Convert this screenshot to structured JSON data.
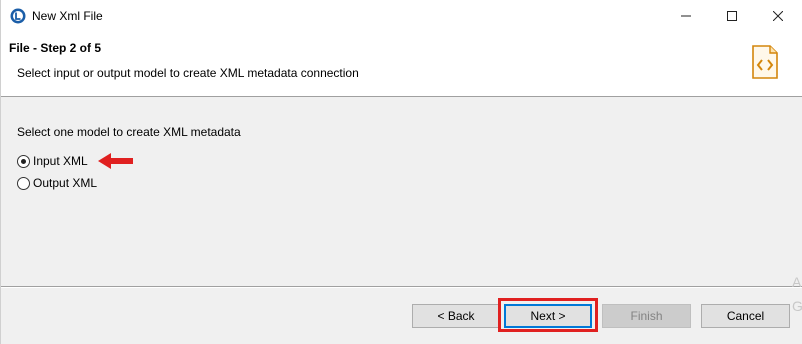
{
  "window": {
    "title": "New Xml File",
    "controls": [
      "minimize",
      "maximize",
      "close"
    ]
  },
  "banner": {
    "step_title": "File - Step 2 of 5",
    "description": "Select input or output model to create XML metadata connection",
    "icon": "xml-file-icon"
  },
  "content": {
    "prompt": "Select one model to create XML metadata",
    "options": [
      {
        "label": "Input XML",
        "selected": true
      },
      {
        "label": "Output XML",
        "selected": false
      }
    ]
  },
  "buttons": {
    "back": "< Back",
    "next": "Next >",
    "finish": "Finish",
    "cancel": "Cancel"
  },
  "colors": {
    "annotation_red": "#e02020",
    "focus_blue": "#0078d7",
    "icon_orange": "#d4860b"
  },
  "watermark": [
    "A",
    "G"
  ]
}
